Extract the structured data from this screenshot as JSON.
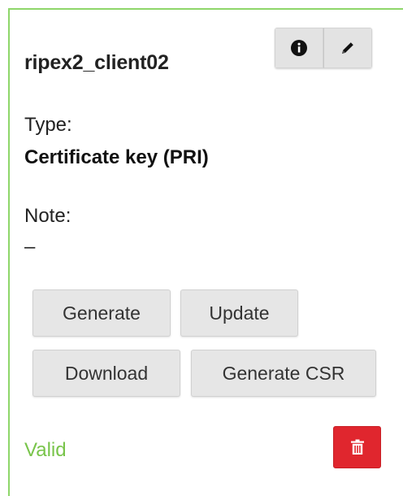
{
  "card": {
    "title": "ripex2_client02",
    "type_label": "Type:",
    "type_value": "Certificate key (PRI)",
    "note_label": "Note:",
    "note_value": "–",
    "status": "Valid",
    "actions": {
      "generate": "Generate",
      "update": "Update",
      "download": "Download",
      "generate_csr": "Generate CSR"
    },
    "icons": {
      "info": "info-icon",
      "edit": "pencil-icon",
      "delete": "trash-icon"
    }
  },
  "colors": {
    "border": "#8ed66a",
    "status": "#78c44a",
    "danger": "#e0262e"
  }
}
